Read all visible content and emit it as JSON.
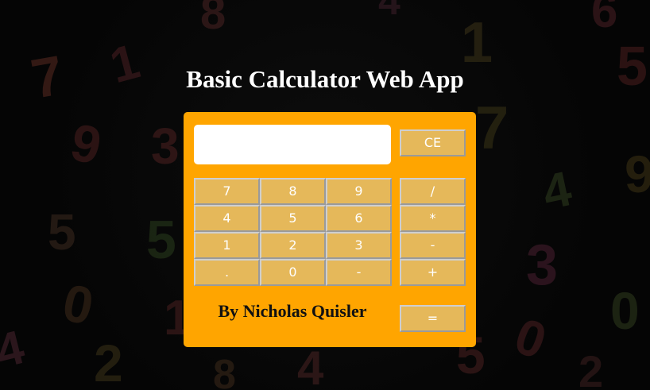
{
  "page": {
    "title": "Basic Calculator Web App",
    "byline": "By Nicholas Quisler"
  },
  "calculator": {
    "display_value": "",
    "clear_label": "CE",
    "equals_label": "=",
    "digit_rows": [
      [
        "7",
        "8",
        "9"
      ],
      [
        "4",
        "5",
        "6"
      ],
      [
        "1",
        "2",
        "3"
      ],
      [
        ".",
        "0",
        "-"
      ]
    ],
    "operators": [
      "/",
      "*",
      "-",
      "+"
    ]
  },
  "background_digits": [
    "7",
    "1",
    "8",
    "4",
    "6",
    "9",
    "3",
    "5",
    "1",
    "7",
    "4",
    "9",
    "5",
    "5",
    "2",
    "0",
    "1",
    "4",
    "3",
    "0",
    "0",
    "2",
    "4",
    "5",
    "8"
  ],
  "colors": {
    "panel": "#ffa500",
    "key": "#e5b85a",
    "key_text": "#ffffff",
    "title": "#ffffff",
    "byline": "#111111",
    "background": "#050505"
  }
}
